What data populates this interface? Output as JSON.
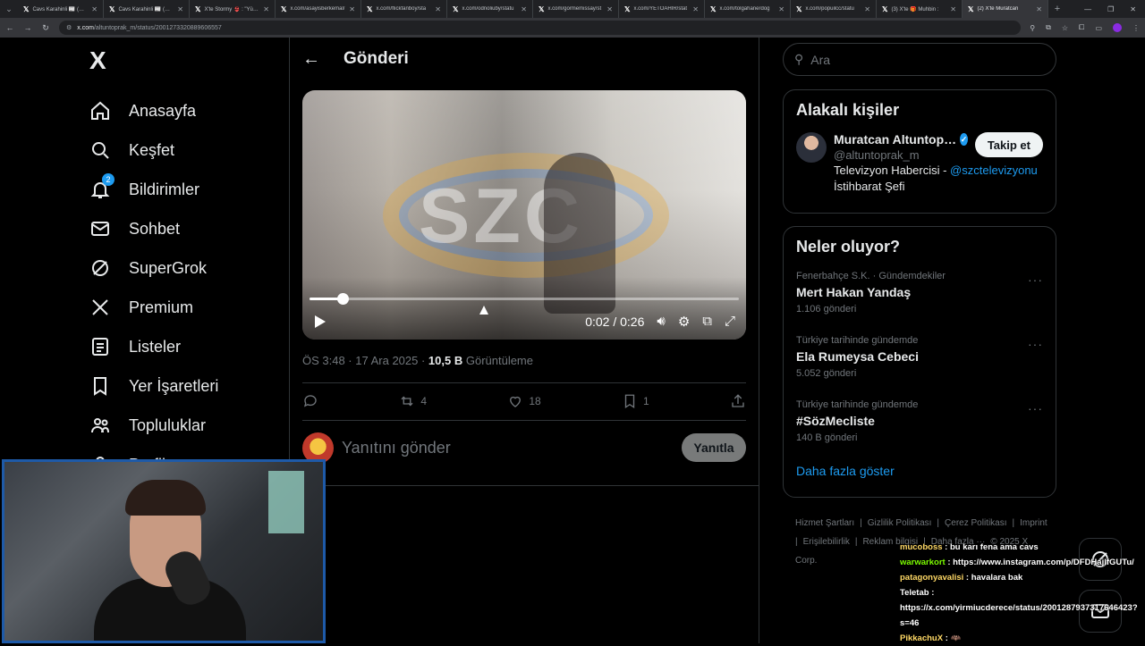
{
  "browser": {
    "tabs": [
      {
        "title": "Cavs Karahinli 📰 (@cr"
      },
      {
        "title": "Cavs Karahinli 📰 (@cr"
      },
      {
        "title": "X'te Stormy 👙 : \"Yüzsü"
      },
      {
        "title": "x.com/asayisberkemal/"
      },
      {
        "title": "x.com/flickfanboy/sta"
      },
      {
        "title": "x.com/odnoliuby/statu"
      },
      {
        "title": "x.com/gormemissay/st"
      },
      {
        "title": "x.com/YETOAHIR/stat"
      },
      {
        "title": "x.com/tolgahanerdog"
      },
      {
        "title": "x.com/popuilcc/statu"
      },
      {
        "title": "(3) X'te 🎁 Muhbin : "
      },
      {
        "title": "(2) X'te Muratcan"
      }
    ],
    "url_domain": "x.com",
    "url_path": "/altuntoprak_m/status/2001273320889606557"
  },
  "nav": {
    "logo": "X",
    "items": [
      {
        "label": "Anasayfa",
        "icon": "home-icon"
      },
      {
        "label": "Keşfet",
        "icon": "search-icon"
      },
      {
        "label": "Bildirimler",
        "icon": "bell-icon",
        "badge": "2"
      },
      {
        "label": "Sohbet",
        "icon": "mail-icon"
      },
      {
        "label": "SuperGrok",
        "icon": "grok-icon"
      },
      {
        "label": "Premium",
        "icon": "x-icon"
      },
      {
        "label": "Listeler",
        "icon": "list-icon"
      },
      {
        "label": "Yer İşaretleri",
        "icon": "bookmark-icon"
      },
      {
        "label": "Topluluklar",
        "icon": "people-icon"
      },
      {
        "label": "Profil",
        "icon": "person-icon"
      }
    ]
  },
  "post": {
    "header_title": "Gönderi",
    "video": {
      "watermark": "SZC",
      "time": "0:02 / 0:26",
      "progress": 0.077
    },
    "timestamp": "ÖS 3:48 · 17 Ara 2025 · ",
    "views_count": "10,5 B",
    "views_label": " Görüntüleme",
    "reposts": "4",
    "likes": "18",
    "bookmarks": "1",
    "reply_placeholder": "Yanıtını gönder",
    "reply_button": "Yanıtla"
  },
  "right": {
    "search_placeholder": "Ara",
    "related_title": "Alakalı kişiler",
    "person": {
      "name": "Muratcan Altuntop…",
      "handle": "@altuntoprak_m",
      "bio_prefix": "Televizyon Habercisi - ",
      "bio_link": "@szctelevizyonu",
      "bio_line2": "İstihbarat Şefi",
      "follow_label": "Takip et"
    },
    "trends_title": "Neler oluyor?",
    "trends": [
      {
        "context": "Fenerbahçe S.K. · Gündemdekiler",
        "name": "Mert Hakan Yandaş",
        "count": "1.106 gönderi"
      },
      {
        "context": "Türkiye tarihinde gündemde",
        "name": "Ela Rumeysa Cebeci",
        "count": "5.052 gönderi"
      },
      {
        "context": "Türkiye tarihinde gündemde",
        "name": "#SözMecliste",
        "count": "140 B gönderi"
      }
    ],
    "show_more": "Daha fazla göster",
    "footer": [
      "Hizmet Şartları",
      "|",
      "Gizlilik Politikası",
      "|",
      "Çerez Politikası",
      "|",
      "Imprint",
      "|",
      "Erişilebilirlik",
      "|",
      "Reklam bilgisi",
      "|",
      "Daha fazla ···",
      "© 2025 X Corp."
    ]
  },
  "chat": [
    {
      "user": "mucoboss",
      "text": " : bu karı fena ama cavs"
    },
    {
      "user": "warwarkort",
      "text": " : https://www.instagram.com/p/DFDHajlfGUTu/"
    },
    {
      "user": "patagonyavalisi",
      "text": " : havalara bak"
    },
    {
      "user": "Teletab",
      "text": " :"
    },
    {
      "user": "",
      "text": "https://x.com/yirmiucderece/status/2001287937317646423?"
    },
    {
      "user": "",
      "text": "s=46"
    },
    {
      "user": "PikkachuX",
      "text": " : 🦇"
    }
  ]
}
